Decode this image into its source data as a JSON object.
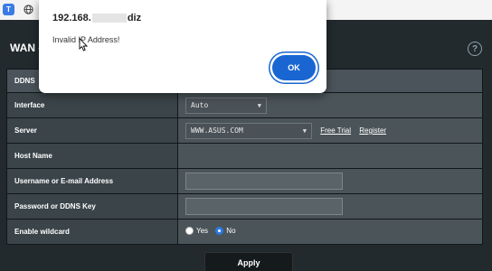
{
  "browser": {
    "app_icon": "blue-square-icon",
    "tab_icon": "globe-icon"
  },
  "page": {
    "title": "WAN -",
    "help_symbol": "?"
  },
  "form": {
    "rows": [
      {
        "label": "DDNS"
      },
      {
        "label": "Interface"
      },
      {
        "label": "Server"
      },
      {
        "label": "Host Name"
      },
      {
        "label": "Username or E-mail Address"
      },
      {
        "label": "Password or DDNS Key"
      },
      {
        "label": "Enable wildcard"
      }
    ],
    "interface_value": "Auto",
    "server_value": "WWW.ASUS.COM",
    "free_trial_link": "Free Trial",
    "register_link": "Register",
    "username_value": "",
    "password_value": "",
    "wildcard_yes": "Yes",
    "wildcard_no": "No",
    "wildcard_selected": "No"
  },
  "apply_label": "Apply",
  "dialog": {
    "title_prefix": "192.168.",
    "title_suffix": "diz",
    "message": "Invalid IP Address!",
    "ok_label": "OK"
  },
  "colors": {
    "accent": "#1966d2",
    "page_bg": "#222a2e"
  }
}
